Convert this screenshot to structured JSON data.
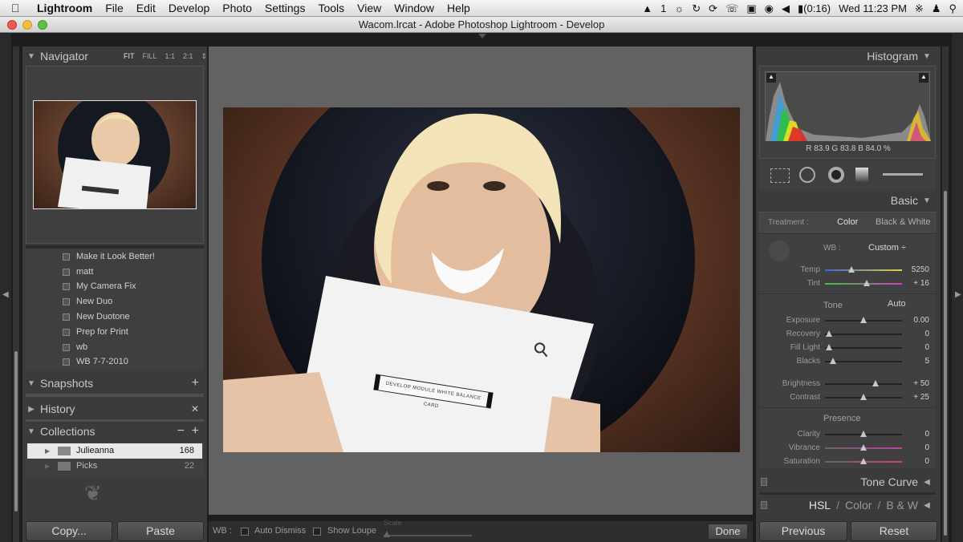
{
  "menubar": {
    "app": "Lightroom",
    "items": [
      "File",
      "Edit",
      "Develop",
      "Photo",
      "Settings",
      "Tools",
      "View",
      "Window",
      "Help"
    ],
    "status_text": "1",
    "battery": "(0:16)",
    "clock": "Wed 11:23 PM"
  },
  "window": {
    "title": "Wacom.lrcat - Adobe Photoshop Lightroom - Develop"
  },
  "navigator": {
    "title": "Navigator",
    "zoom_options": [
      "FIT",
      "FILL",
      "1:1",
      "2:1"
    ]
  },
  "presets": [
    "Make it Look Better!",
    "matt",
    "My Camera Fix",
    "New Duo",
    "New Duotone",
    "Prep for Print",
    "wb",
    "WB 7-7-2010"
  ],
  "snapshots": {
    "title": "Snapshots",
    "add": "+"
  },
  "history": {
    "title": "History",
    "clear": "✕"
  },
  "collections": {
    "title": "Collections",
    "minus": "−",
    "plus": "+",
    "items": [
      {
        "name": "Julieanna",
        "count": "168"
      },
      {
        "name": "Picks",
        "count": "22"
      }
    ]
  },
  "left_buttons": {
    "copy": "Copy...",
    "paste": "Paste"
  },
  "photo": {
    "card_text": "DEVELOP MODULE WHITE BALANCE CARD"
  },
  "toolbar": {
    "wb_label": "WB :",
    "auto_dismiss": "Auto Dismiss",
    "show_loupe": "Show Loupe",
    "scale": "Scale",
    "done": "Done"
  },
  "histogram": {
    "title": "Histogram",
    "readout": "R 83.9  G 83.8  B 84.0 %"
  },
  "basic": {
    "title": "Basic",
    "treatment_label": "Treatment :",
    "treatment_color": "Color",
    "treatment_bw": "Black & White",
    "wb_label": "WB :",
    "wb_value": "Custom ÷",
    "tone_label": "Tone",
    "auto": "Auto",
    "presence_label": "Presence",
    "sliders": [
      {
        "label": "Temp",
        "value": "5250",
        "pos": 0.34
      },
      {
        "label": "Tint",
        "value": "+ 16",
        "pos": 0.54
      },
      {
        "label": "Exposure",
        "value": "0.00",
        "pos": 0.5
      },
      {
        "label": "Recovery",
        "value": "0",
        "pos": 0.05
      },
      {
        "label": "Fill Light",
        "value": "0",
        "pos": 0.05
      },
      {
        "label": "Blacks",
        "value": "5",
        "pos": 0.1
      },
      {
        "label": "Brightness",
        "value": "+ 50",
        "pos": 0.66
      },
      {
        "label": "Contrast",
        "value": "+ 25",
        "pos": 0.5
      },
      {
        "label": "Clarity",
        "value": "0",
        "pos": 0.5
      },
      {
        "label": "Vibrance",
        "value": "0",
        "pos": 0.5
      },
      {
        "label": "Saturation",
        "value": "0",
        "pos": 0.5
      }
    ]
  },
  "tone_curve": {
    "title": "Tone Curve"
  },
  "hsl": {
    "hsl": "HSL",
    "sep1": "/",
    "color": "Color",
    "sep2": "/",
    "bw": "B & W"
  },
  "right_buttons": {
    "previous": "Previous",
    "reset": "Reset"
  },
  "colors": {
    "accent": "#c8c8c8",
    "panel": "#3b3b3b",
    "center": "#626262"
  }
}
